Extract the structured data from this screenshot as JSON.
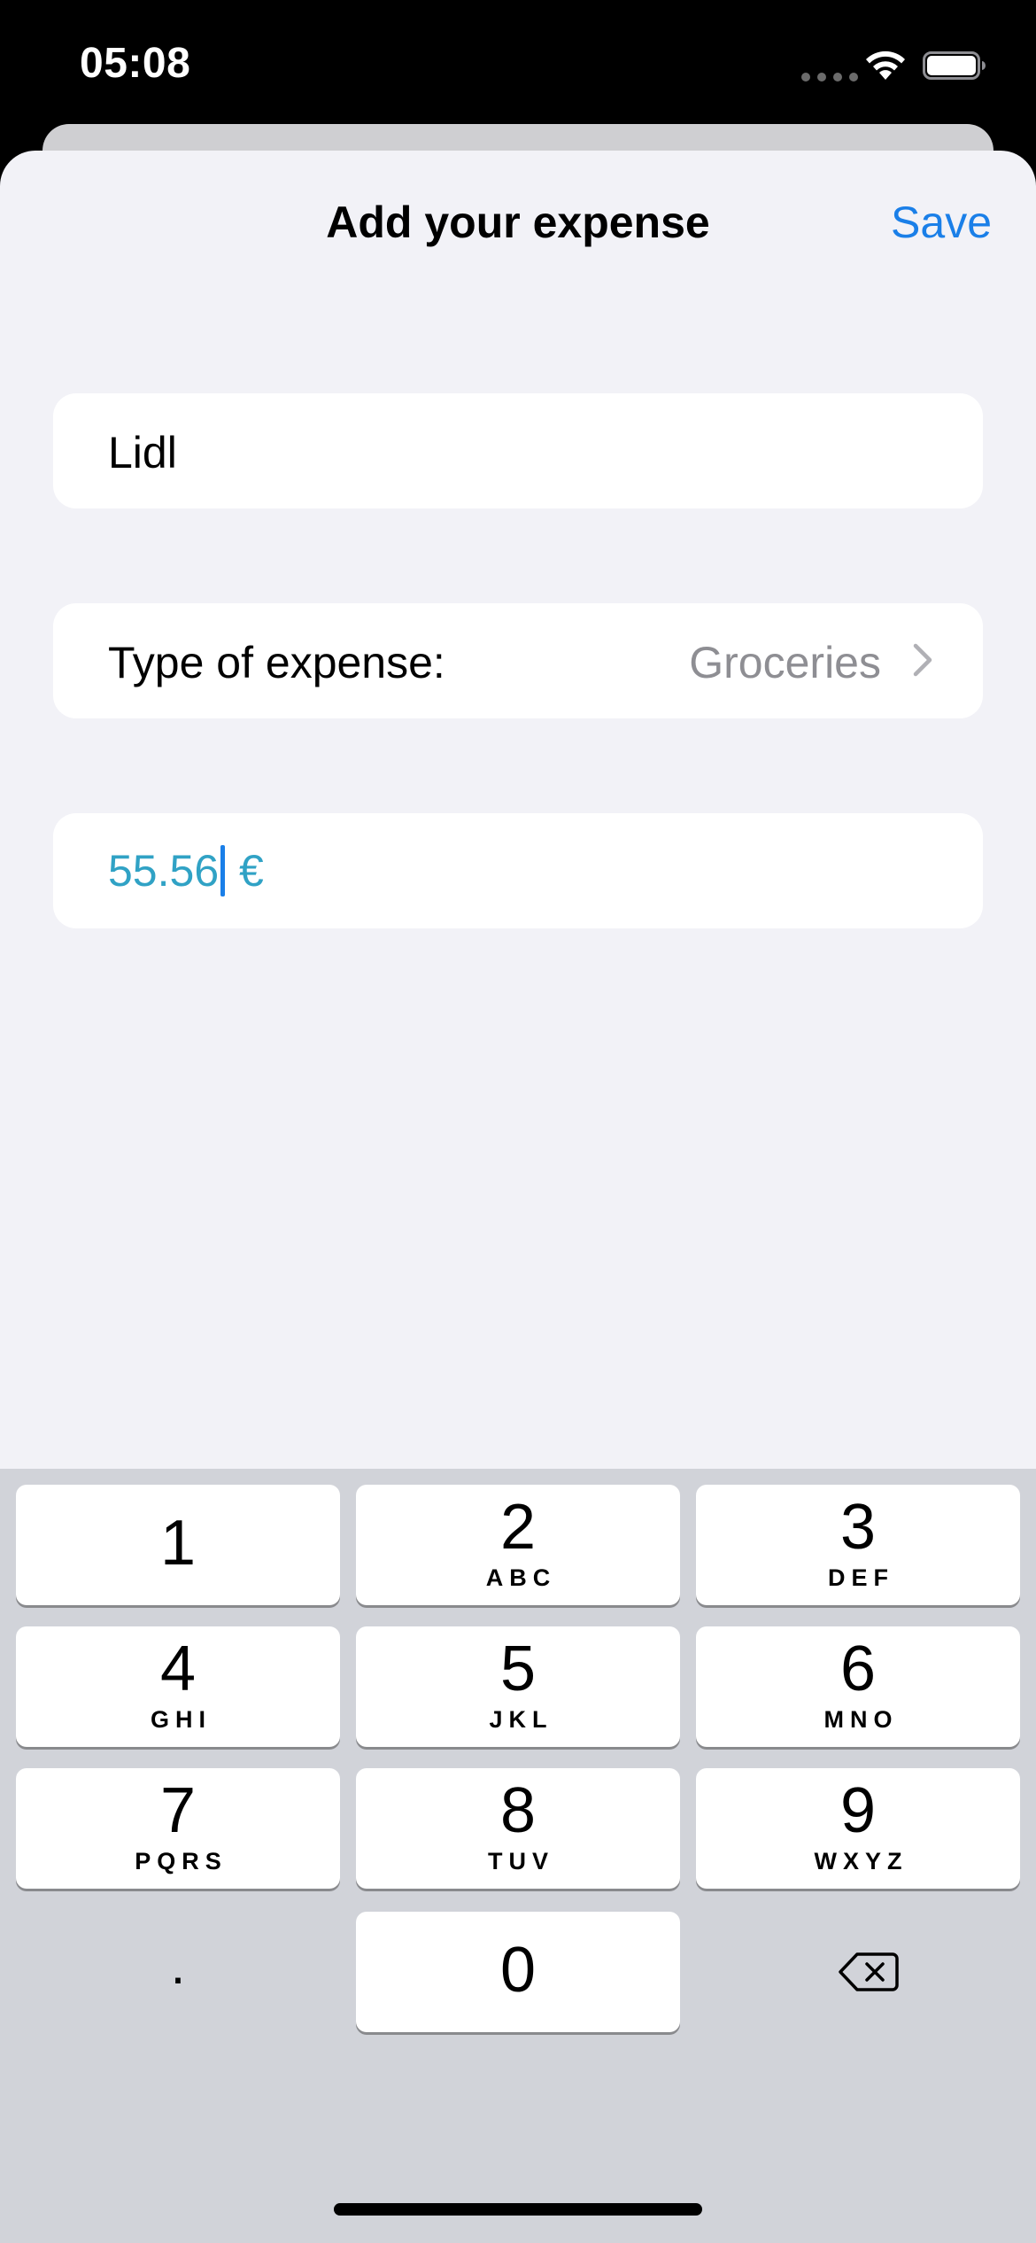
{
  "status_bar": {
    "time": "05:08"
  },
  "nav": {
    "title": "Add your expense",
    "save_label": "Save"
  },
  "form": {
    "name_value": "Lidl",
    "type_label": "Type of expense:",
    "type_value": "Groceries",
    "amount_value": "55.56",
    "currency": " €"
  },
  "keyboard": {
    "keys": [
      {
        "digit": "1",
        "letters": ""
      },
      {
        "digit": "2",
        "letters": "ABC"
      },
      {
        "digit": "3",
        "letters": "DEF"
      },
      {
        "digit": "4",
        "letters": "GHI"
      },
      {
        "digit": "5",
        "letters": "JKL"
      },
      {
        "digit": "6",
        "letters": "MNO"
      },
      {
        "digit": "7",
        "letters": "PQRS"
      },
      {
        "digit": "8",
        "letters": "TUV"
      },
      {
        "digit": "9",
        "letters": "WXYZ"
      }
    ],
    "decimal_label": ".",
    "zero_label": "0"
  },
  "colors": {
    "accent": "#1a7fe8",
    "amount_text": "#30a2c5",
    "sheet_background": "#f2f2f7",
    "keyboard_background": "#d1d3d9"
  },
  "icons": [
    "cellular-icon",
    "wifi-icon",
    "battery-icon",
    "chevron-right-icon",
    "delete-backspace-icon"
  ]
}
